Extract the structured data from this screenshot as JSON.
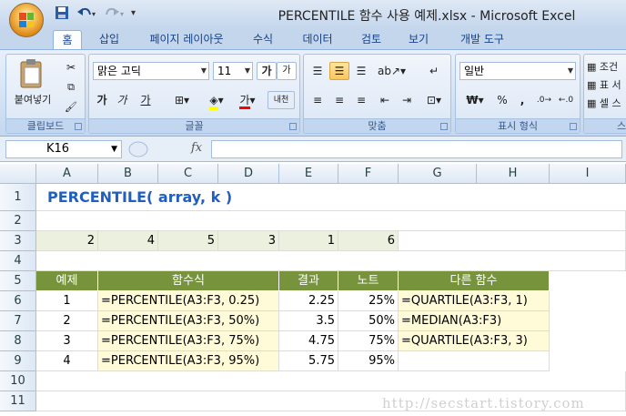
{
  "window": {
    "title": "PERCENTILE 함수 사용 예제.xlsx - Microsoft Excel",
    "qat": [
      "save-icon",
      "undo-icon",
      "redo-icon",
      "customize-icon"
    ]
  },
  "tabs": [
    "홈",
    "삽입",
    "페이지 레이아웃",
    "수식",
    "데이터",
    "검토",
    "보기",
    "개발 도구"
  ],
  "ribbon": {
    "clipboard": {
      "label": "클립보드",
      "paste": "붙여넣기"
    },
    "font": {
      "label": "글꼴",
      "name": "맑은 고딕",
      "size": "11",
      "bold": "가",
      "italic": "가",
      "underline": "가",
      "grow": "가",
      "shrink": "가",
      "phonetic": "내천"
    },
    "alignment": {
      "label": "맞춤"
    },
    "number": {
      "label": "표시 형식",
      "format": "일반",
      "currency": "₩",
      "percent": "%",
      "comma": ","
    },
    "styles": {
      "conditional": "조건",
      "table": "표 서",
      "cell": "셀 스"
    },
    "styles_label": "스"
  },
  "formula_bar": {
    "name_box": "K16",
    "fx": "fx",
    "formula": ""
  },
  "columns": [
    "A",
    "B",
    "C",
    "D",
    "E",
    "F",
    "G",
    "H",
    "I"
  ],
  "rows": [
    "1",
    "2",
    "3",
    "4",
    "5",
    "6",
    "7",
    "8",
    "9",
    "10",
    "11"
  ],
  "sheet": {
    "title": "PERCENTILE( array, k )",
    "row3": [
      "2",
      "4",
      "5",
      "3",
      "1",
      "6"
    ],
    "headers": {
      "example": "예제",
      "formula": "함수식",
      "result": "결과",
      "note": "노트",
      "other": "다른 함수"
    },
    "examples": [
      {
        "no": "1",
        "formula": "=PERCENTILE(A3:F3, 0.25)",
        "result": "2.25",
        "note": "25%",
        "other": "=QUARTILE(A3:F3, 1)"
      },
      {
        "no": "2",
        "formula": "=PERCENTILE(A3:F3, 50%)",
        "result": "3.5",
        "note": "50%",
        "other": "=MEDIAN(A3:F3)"
      },
      {
        "no": "3",
        "formula": "=PERCENTILE(A3:F3, 75%)",
        "result": "4.75",
        "note": "75%",
        "other": "=QUARTILE(A3:F3, 3)"
      },
      {
        "no": "4",
        "formula": "=PERCENTILE(A3:F3, 95%)",
        "result": "5.75",
        "note": "95%",
        "other": ""
      }
    ]
  },
  "watermark": "http://secstart.tistory.com",
  "colors": {
    "header_green": "#77933c",
    "title_blue": "#1f5fbf",
    "light_green": "#ebf1de",
    "light_yellow": "#fffbd8"
  }
}
